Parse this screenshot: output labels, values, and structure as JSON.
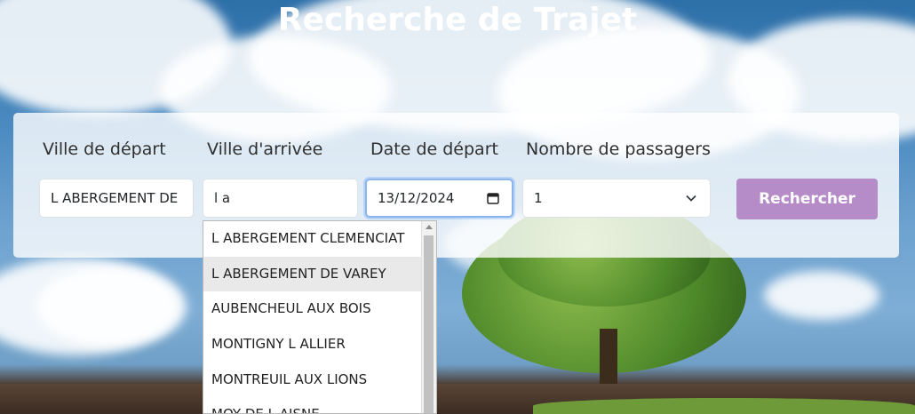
{
  "page": {
    "title": "Recherche de Trajet"
  },
  "form": {
    "depart_label": "Ville de départ",
    "arrivee_label": "Ville d'arrivée",
    "date_label": "Date de départ",
    "passagers_label": "Nombre de passagers",
    "depart_value": "L ABERGEMENT DE",
    "arrivee_value": "l a",
    "date_value": "13/12/2024",
    "passagers_value": "1",
    "submit_label": "Rechercher",
    "calendar_icon": "calendar-icon",
    "select_icon": "chevron-down-icon"
  },
  "suggestions": {
    "items": [
      "L ABERGEMENT CLEMENCIAT",
      "L ABERGEMENT DE VAREY",
      "AUBENCHEUL AUX BOIS",
      "MONTIGNY L ALLIER",
      "MONTREUIL AUX LIONS",
      "MOY DE L AISNE"
    ],
    "hovered_index": 1
  },
  "colors": {
    "button": "#b68cc8",
    "focus_border": "#8bb3ec"
  }
}
